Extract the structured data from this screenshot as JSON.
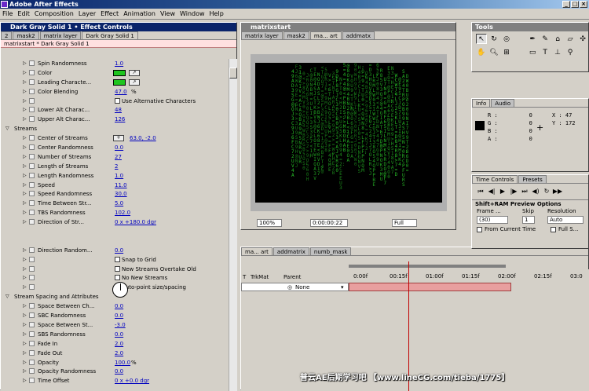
{
  "app": {
    "title": "Adobe After Effects"
  },
  "menu": [
    "File",
    "Edit",
    "Composition",
    "Layer",
    "Effect",
    "Animation",
    "View",
    "Window",
    "Help"
  ],
  "effect_controls": {
    "title": "Dark Gray Solid 1 • Effect Controls",
    "tabs": [
      "2",
      "mask2",
      "matrix layer",
      "Dark Gray Solid 1"
    ],
    "subtitle": "matrixstart * Dark Gray Solid 1",
    "rows": [
      {
        "label": "Spin Randomness",
        "value": "1.0",
        "kind": "prop"
      },
      {
        "label": "Color",
        "kind": "color"
      },
      {
        "label": "Leading Characte...",
        "kind": "color"
      },
      {
        "label": "Color Blending",
        "value": "47.0",
        "unit": "%",
        "kind": "prop"
      },
      {
        "label": "",
        "check": "Use Alternative Characters",
        "kind": "check"
      },
      {
        "label": "Lower Alt Charac...",
        "value": "48",
        "kind": "prop"
      },
      {
        "label": "Upper Alt Charac...",
        "value": "126",
        "kind": "prop"
      },
      {
        "label": "Streams",
        "kind": "section"
      },
      {
        "label": "Center of Streams",
        "value": "63.0, -2.0",
        "kind": "point"
      },
      {
        "label": "Center Randomness",
        "value": "0.0",
        "kind": "prop"
      },
      {
        "label": "Number of Streams",
        "value": "27",
        "kind": "prop"
      },
      {
        "label": "Length of Streams",
        "value": "2",
        "kind": "prop"
      },
      {
        "label": "Length Randomness",
        "value": "1.0",
        "kind": "prop"
      },
      {
        "label": "Speed",
        "value": "11.0",
        "kind": "prop"
      },
      {
        "label": "Speed Randomness",
        "value": "30.0",
        "kind": "prop"
      },
      {
        "label": "Time Between Str...",
        "value": "5.0",
        "kind": "prop"
      },
      {
        "label": "TBS Randomness",
        "value": "102.0",
        "kind": "prop"
      },
      {
        "label": "Direction of Str...",
        "value": "0 x +180.0 dgr",
        "kind": "prop"
      },
      {
        "label": "",
        "kind": "gap"
      },
      {
        "label": "",
        "kind": "gap"
      },
      {
        "label": "Direction Random...",
        "value": "0.0",
        "kind": "prop"
      },
      {
        "label": "",
        "check": "Snap to Grid",
        "kind": "check"
      },
      {
        "label": "",
        "check": "New Streams Overtake Old",
        "kind": "check"
      },
      {
        "label": "",
        "check": "No New Streams",
        "kind": "check"
      },
      {
        "label": "",
        "check": "Auto-point size/spacing",
        "kind": "check"
      },
      {
        "label": "Stream Spacing and Attributes",
        "kind": "section"
      },
      {
        "label": "Space Between Ch...",
        "value": "0.0",
        "kind": "prop"
      },
      {
        "label": "SBC Randomness",
        "value": "0.0",
        "kind": "prop"
      },
      {
        "label": "Space Between St...",
        "value": "-3.0",
        "kind": "prop"
      },
      {
        "label": "SBS Randomness",
        "value": "0.0",
        "kind": "prop"
      },
      {
        "label": "Fade In",
        "value": "2.0",
        "kind": "prop"
      },
      {
        "label": "Fade Out",
        "value": "2.0",
        "kind": "prop"
      },
      {
        "label": "Opacity",
        "value": "100.0",
        "unit": "%",
        "kind": "prop"
      },
      {
        "label": "Opacity Randomness",
        "value": "0.0",
        "kind": "prop"
      },
      {
        "label": "Time Offset",
        "value": "0 x +0.0 dgr",
        "kind": "prop"
      }
    ]
  },
  "comp": {
    "title": "matrixstart",
    "tabs": [
      "matrix layer",
      "mask2",
      "ma... art",
      "addmatx"
    ],
    "zoom": "100%",
    "timecode": "0:00:00:22",
    "resolution": "Full"
  },
  "timeline": {
    "tabs": [
      "ma... art",
      "addmatrix",
      "numb_mask"
    ],
    "cols": [
      "T",
      "TrkMat",
      "Parent"
    ],
    "parent_value": "None",
    "ruler": [
      "0:00f",
      "00:15f",
      "01:00f",
      "01:15f",
      "02:00f",
      "02:15f",
      "03:0"
    ]
  },
  "tools": {
    "title": "Tools"
  },
  "info": {
    "tabs": [
      "Info",
      "Audio"
    ],
    "r": "0",
    "g": "0",
    "b": "0",
    "a": "0",
    "x": "X : 47",
    "y": "Y : 172"
  },
  "time_controls": {
    "tabs": [
      "Time Controls",
      "Presets"
    ],
    "preview_title": "Shift+RAM Preview Options",
    "frame_rate_label": "Frame ...",
    "skip_label": "Skip",
    "resolution_label": "Resolution",
    "frame_rate": "(30)",
    "skip": "1",
    "resolution": "Auto",
    "from_current": "From Current Time",
    "full_screen": "Full S..."
  },
  "watermark": "普云AE后期学习吧 【www.lineCG.com/tieba/1775】"
}
